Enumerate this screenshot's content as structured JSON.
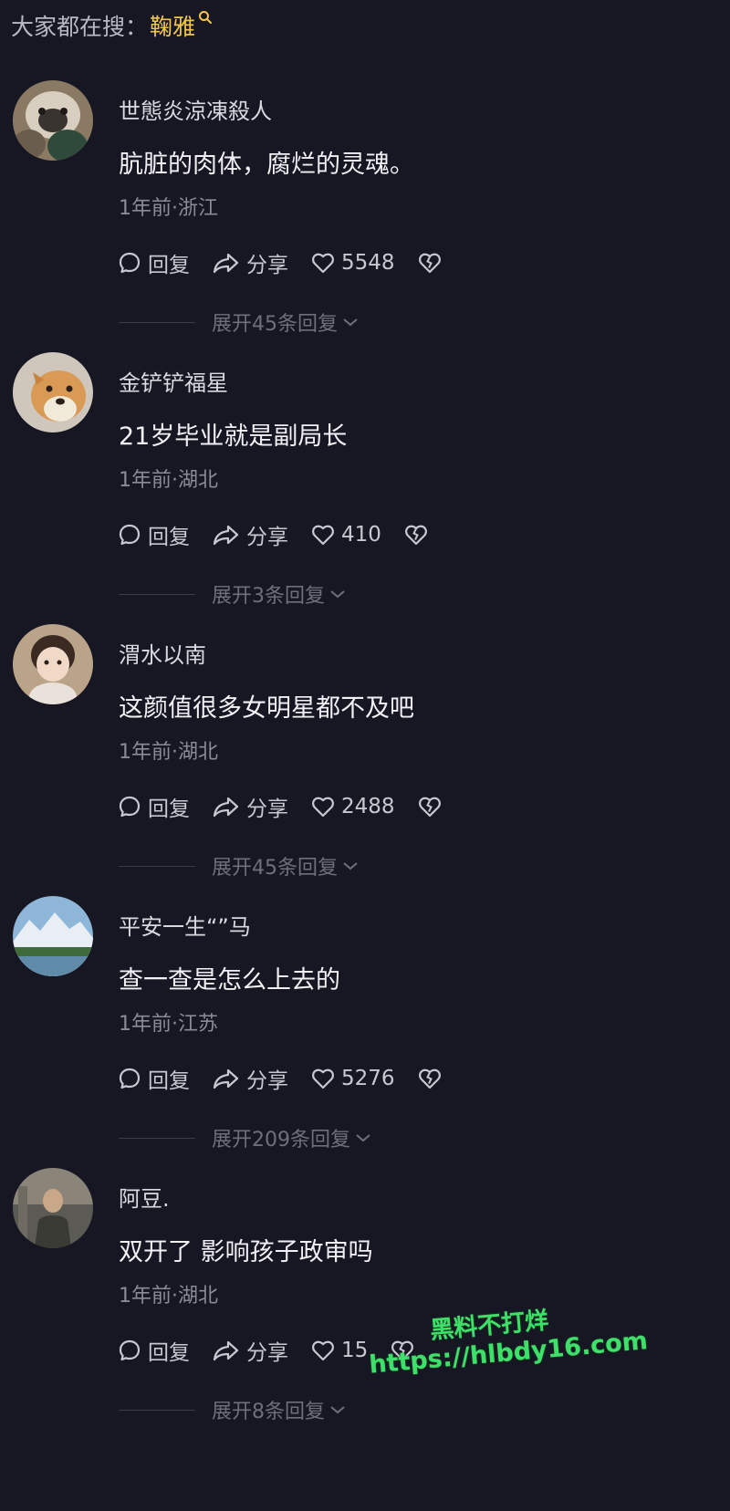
{
  "search": {
    "prefix": "大家都在搜：",
    "keyword": "鞠雅",
    "icon": "search-icon"
  },
  "actions": {
    "reply_label": "回复",
    "share_label": "分享"
  },
  "comments": [
    {
      "username": "世態炎涼凍殺人",
      "text": "肮脏的肉体，腐烂的灵魂。",
      "meta": "1年前·浙江",
      "likes": "5548",
      "expand_label": "展开45条回复"
    },
    {
      "username": "金铲铲福星",
      "text": "21岁毕业就是副局长",
      "meta": "1年前·湖北",
      "likes": "410",
      "expand_label": "展开3条回复"
    },
    {
      "username": "渭水以南",
      "text": "这颜值很多女明星都不及吧",
      "meta": "1年前·湖北",
      "likes": "2488",
      "expand_label": "展开45条回复"
    },
    {
      "username": "平安一生“”马",
      "text": "查一查是怎么上去的",
      "meta": "1年前·江苏",
      "likes": "5276",
      "expand_label": "展开209条回复"
    },
    {
      "username": "阿豆.",
      "text": "双开了 影响孩子政审吗",
      "meta": "1年前·湖北",
      "likes": "15",
      "expand_label": "展开8条回复"
    }
  ],
  "watermark": {
    "line1": "黑料不打烊",
    "line2": "https://hlbdy16.com"
  },
  "colors": {
    "background": "#161722",
    "keyword": "#f3c64d",
    "watermark": "#3ee06a"
  }
}
